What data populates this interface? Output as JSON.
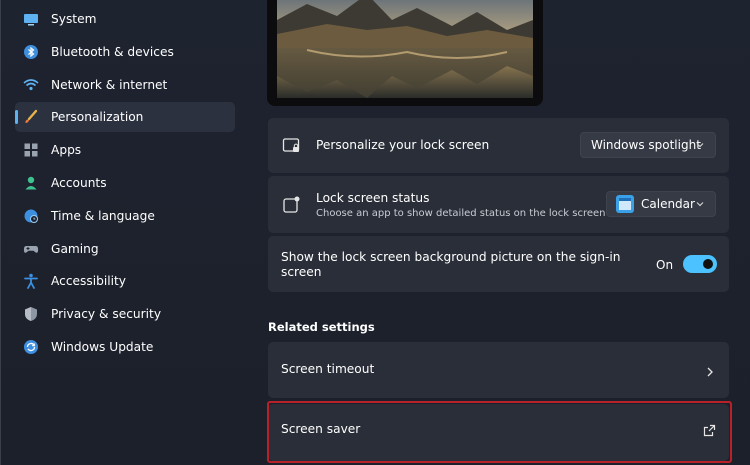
{
  "sidebar": {
    "items": [
      {
        "label": "System",
        "icon": "monitor-icon"
      },
      {
        "label": "Bluetooth & devices",
        "icon": "bluetooth-icon"
      },
      {
        "label": "Network & internet",
        "icon": "wifi-icon"
      },
      {
        "label": "Personalization",
        "icon": "brush-icon",
        "selected": true
      },
      {
        "label": "Apps",
        "icon": "apps-grid-icon"
      },
      {
        "label": "Accounts",
        "icon": "person-icon"
      },
      {
        "label": "Time & language",
        "icon": "globe-clock-icon"
      },
      {
        "label": "Gaming",
        "icon": "gamepad-icon"
      },
      {
        "label": "Accessibility",
        "icon": "accessibility-icon"
      },
      {
        "label": "Privacy & security",
        "icon": "shield-icon"
      },
      {
        "label": "Windows Update",
        "icon": "sync-icon"
      }
    ]
  },
  "lock_screen": {
    "personalize": {
      "label": "Personalize your lock screen",
      "value": "Windows spotlight"
    },
    "status": {
      "label": "Lock screen status",
      "description": "Choose an app to show detailed status on the lock screen",
      "value": "Calendar"
    },
    "background": {
      "label_line1": "Show the lock screen background picture on the sign-in",
      "label_line2": "screen",
      "toggle_label": "On",
      "toggle_on": true
    }
  },
  "related": {
    "title": "Related settings",
    "screen_timeout": "Screen timeout",
    "screen_saver": "Screen saver"
  },
  "colors": {
    "accent": "#4cc2ff",
    "highlight": "#b8202a"
  }
}
